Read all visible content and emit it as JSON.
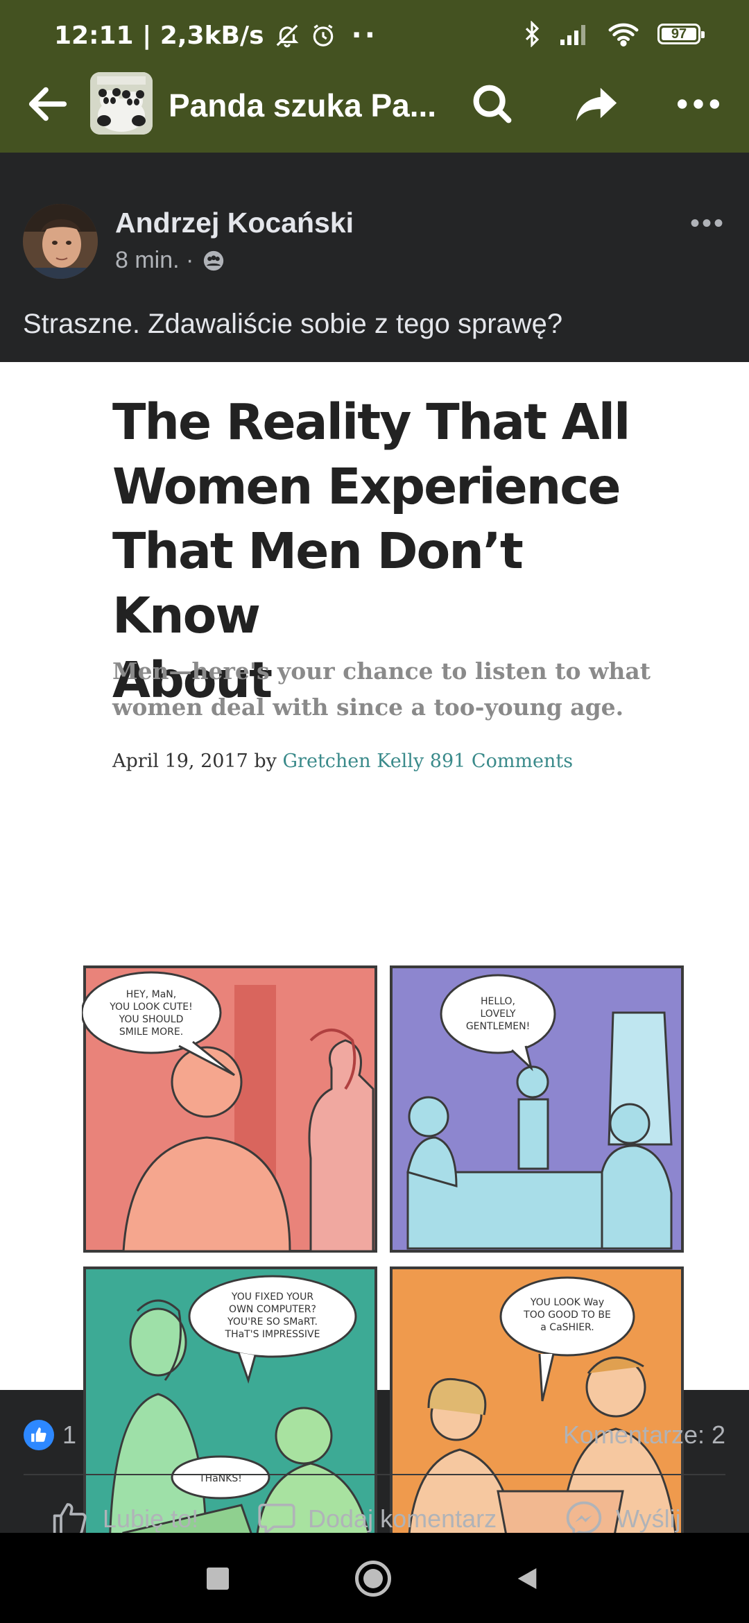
{
  "status_bar": {
    "time_speed": "12:11 | 2,3kB/s",
    "more_dots": "··",
    "battery": "97",
    "battery_level": 0.97
  },
  "app_bar": {
    "title": "Panda szuka Pa...",
    "icons": [
      "back-arrow-icon",
      "search-icon",
      "share-icon",
      "more-icon"
    ]
  },
  "post": {
    "author": "Andrzej Kocański",
    "time": "8 min. ·",
    "audience_icon": "group-icon",
    "text": "Straszne. Zdawaliście sobie z tego sprawę?",
    "image": {
      "title_lines": [
        "The Reality That All",
        "Women Experience",
        "That Men Don’t Know",
        "About"
      ],
      "subtitle_lines": [
        "Men—here's your chance to listen to what",
        "women deal with since a too-young age."
      ],
      "byline_prefix": "April 19, 2017 by ",
      "byline_author": "Gretchen Kelly",
      "byline_comments": "891 Comments",
      "panels": [
        {
          "bubble_lines": [
            "HEY, MaN,",
            "YOU LOOK CUTE!",
            "YOU SHOULD",
            "SMILE MORE."
          ],
          "color": "#e9837a"
        },
        {
          "bubble_lines": [
            "HELLO,",
            "LOVELY",
            "GENTLEMEN!"
          ],
          "color": "#8d86cf"
        },
        {
          "bubble_lines": [
            "YOU FIXED YOUR",
            "OWN COMPUTER?",
            "YOU'RE SO SMaRT.",
            "THaT'S IMPRESSIVE"
          ],
          "second_bubble": "THaNKS!",
          "color": "#3daa95"
        },
        {
          "bubble_lines": [
            "YOU LOOK Way",
            "TOO GOOD TO BE",
            "a CaSHIER."
          ],
          "color": "#ef9a4d"
        }
      ]
    }
  },
  "reactions": {
    "like_count": "1",
    "comments": "Komentarze: 2"
  },
  "actions": {
    "like": "Lubię to!",
    "comment": "Dodaj komentarz",
    "send": "Wyślij"
  },
  "nav": [
    "recents-button",
    "home-button",
    "back-button"
  ]
}
